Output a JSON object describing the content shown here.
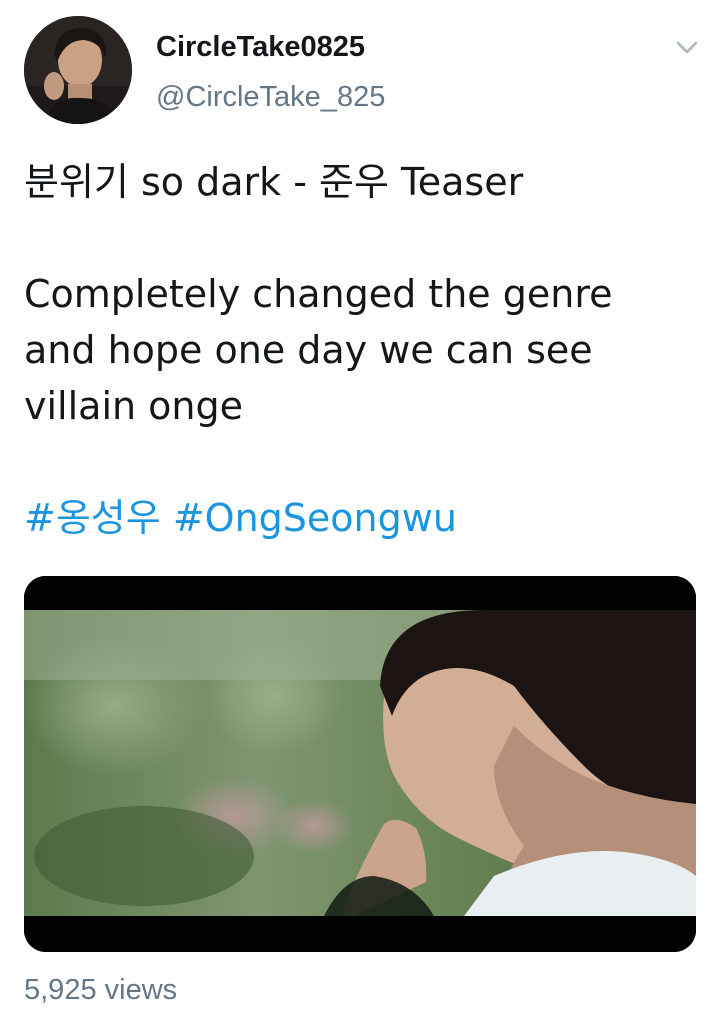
{
  "tweet": {
    "author": {
      "display_name": "CircleTake0825",
      "handle": "@CircleTake_825"
    },
    "text_lines": [
      "분위기 so dark - 준우 Teaser",
      "Completely changed the genre",
      "and hope one day we can see",
      "villain onge"
    ],
    "hashtags": [
      "#옹성우",
      "#OngSeongwu"
    ],
    "views": "5,925 views"
  },
  "icons": {
    "menu": "chevron-down-icon",
    "avatar": "profile-photo",
    "media": "video-thumbnail"
  },
  "colors": {
    "text": "#14171a",
    "secondary": "#657786",
    "link": "#1b95e0"
  }
}
